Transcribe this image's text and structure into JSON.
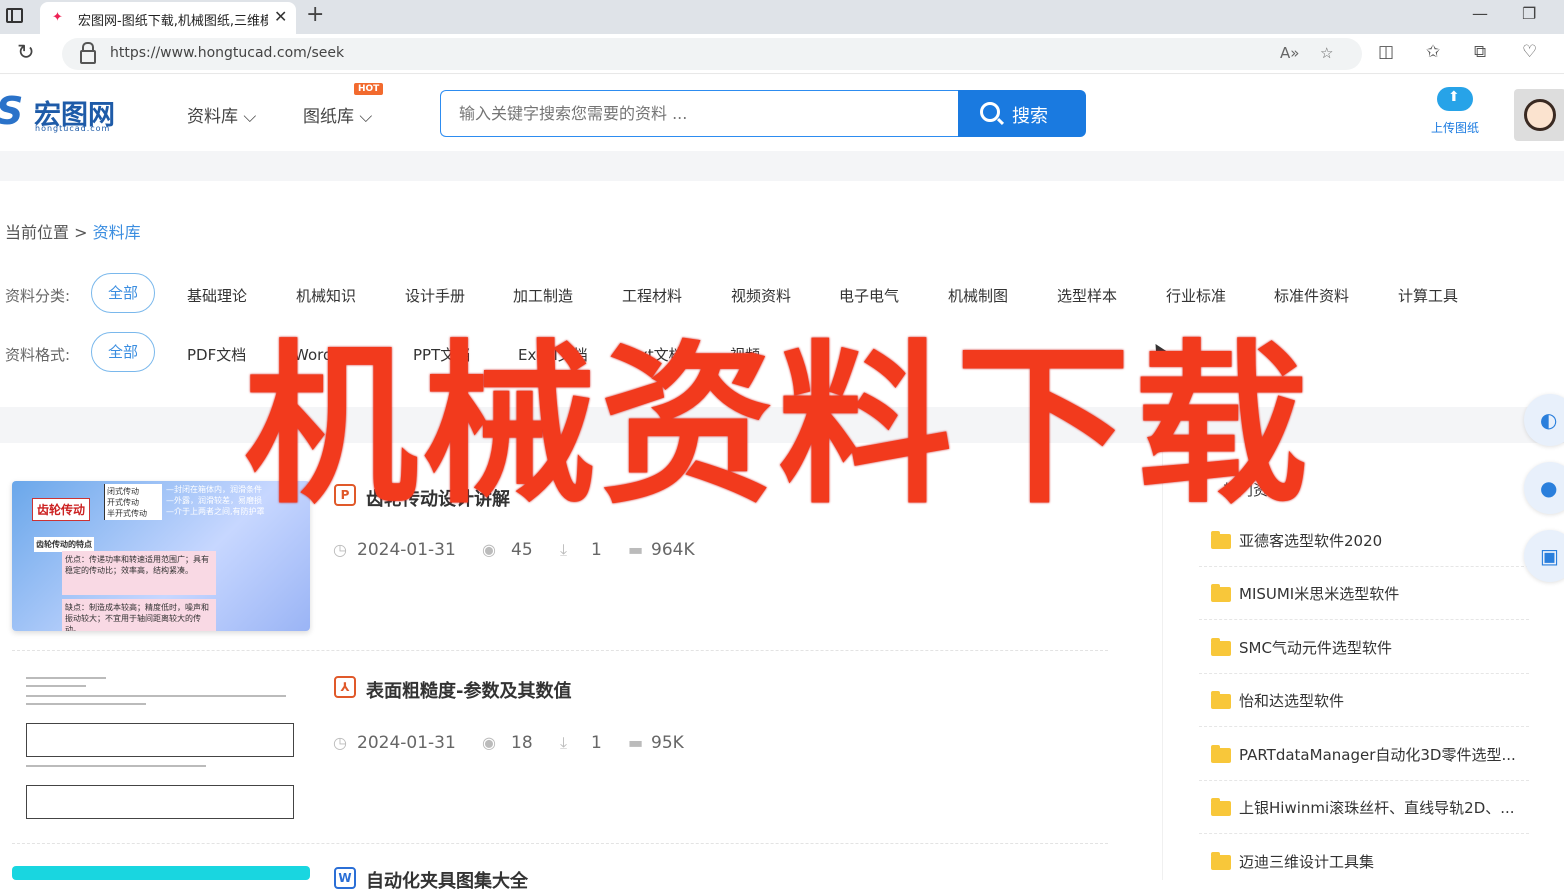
{
  "browser": {
    "tab_title": "宏图网-图纸下载,机械图纸,三维模",
    "new_tab_icon": "plus-icon",
    "url": "https://www.hongtucad.com/seek"
  },
  "header": {
    "logo_text": "宏图网",
    "logo_sub": "hongtucad.com",
    "nav": [
      {
        "label": "资料库"
      },
      {
        "label": "图纸库"
      }
    ],
    "hot_badge": "HOT",
    "search_placeholder": "输入关键字搜索您需要的资料 ...",
    "search_button": "搜索",
    "upload_label": "上传图纸"
  },
  "breadcrumb": {
    "prefix": "当前位置",
    "separator": ">",
    "current": "资料库"
  },
  "filters": {
    "category_label": "资料分类:",
    "category_all": "全部",
    "categories": [
      "基础理论",
      "机械知识",
      "设计手册",
      "加工制造",
      "工程材料",
      "视频资料",
      "电子电气",
      "机械制图",
      "选型样本",
      "行业标准",
      "标准件资料",
      "计算工具"
    ],
    "format_label": "资料格式:",
    "format_all": "全部",
    "formats": [
      "PDF文档",
      "Word文档",
      "PPT文档",
      "Excel文档",
      "txt文档",
      "视频"
    ]
  },
  "documents": [
    {
      "icon": "ppt-doc-icon",
      "title": "齿轮传动设计讲解",
      "date": "2024-01-31",
      "views": "45",
      "downloads": "1",
      "size": "964K",
      "thumb": {
        "tag": "齿轮传动",
        "types": [
          "闭式传动",
          "开式传动",
          "半开式传动"
        ],
        "notes": [
          "—封闭在箱体内，润滑条件",
          "—外露，润滑较差，易磨损",
          "—介于上两者之间,有防护罩"
        ],
        "feature_title": "齿轮传动的特点",
        "pros": "优点：传递功率和转速适用范围广；具有稳定的传动比；效率高，结构紧凑。",
        "cons": "缺点：制造成本较高；精度低时，噪声和振动较大；不宜用于轴间距离较大的传动。"
      }
    },
    {
      "icon": "pdf-doc-icon",
      "title": "表面粗糙度-参数及其数值",
      "date": "2024-01-31",
      "views": "18",
      "downloads": "1",
      "size": "95K"
    },
    {
      "icon": "word-doc-icon",
      "title": "自动化夹具图集大全"
    }
  ],
  "right_panel": {
    "heading": "热门资料",
    "items": [
      "亚德客选型软件2020",
      "MISUMI米思米选型软件",
      "SMC气动元件选型软件",
      "怡和达选型软件",
      "PARTdataManager自动化3D零件选型...",
      "上银Hiwinmi滚珠丝杆、直线导轨2D、...",
      "迈迪三维设计工具集"
    ]
  },
  "overlay_text": "机械资料下载",
  "colors": {
    "accent": "#1a7ae0",
    "link": "#3a8de0",
    "hot": "#f26a2e",
    "overlay": "#f23a1d",
    "folder": "#f8c73a"
  }
}
